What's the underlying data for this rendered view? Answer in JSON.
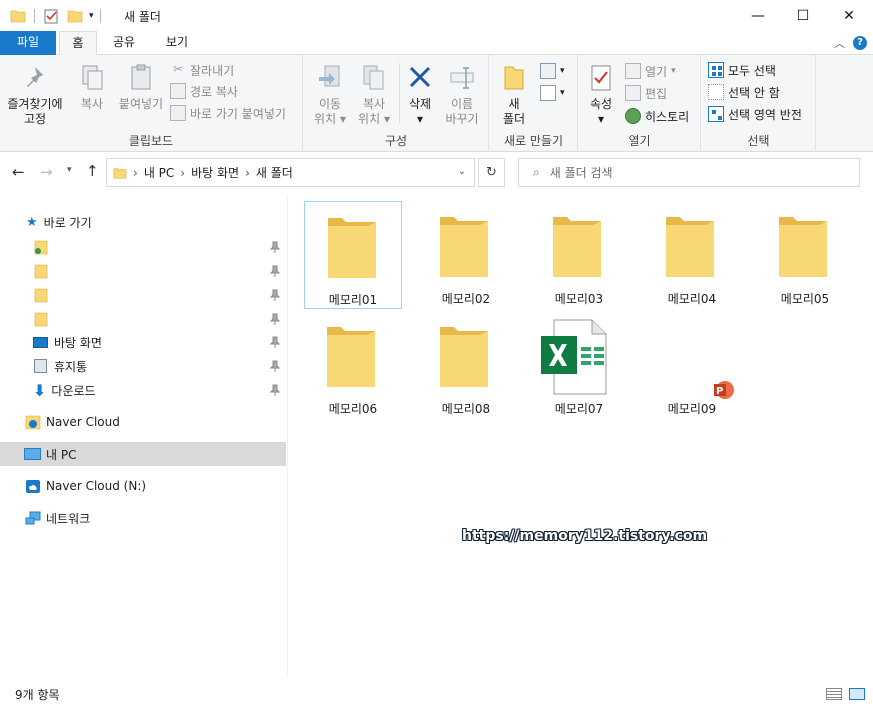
{
  "window": {
    "title": "새 폴더",
    "minimize": "—",
    "maximize": "☐",
    "close": "✕"
  },
  "tabs": {
    "file": "파일",
    "home": "홈",
    "share": "공유",
    "view": "보기"
  },
  "ribbon": {
    "clipboard": {
      "label": "클립보드",
      "pin_line1": "즐겨찾기에",
      "pin_line2": "고정",
      "copy": "복사",
      "paste": "붙여넣기",
      "cut": "잘라내기",
      "copy_path": "경로 복사",
      "paste_shortcut": "바로 가기 붙여넣기"
    },
    "organize": {
      "label": "구성",
      "move_line1": "이동",
      "move_line2": "위치",
      "copy_line1": "복사",
      "copy_line2": "위치",
      "delete": "삭제",
      "rename_line1": "이름",
      "rename_line2": "바꾸기"
    },
    "new": {
      "label": "새로 만들기",
      "new_folder_line1": "새",
      "new_folder_line2": "폴더"
    },
    "open": {
      "label": "열기",
      "properties": "속성",
      "open": "열기",
      "edit": "편집",
      "history": "히스토리"
    },
    "select": {
      "label": "선택",
      "select_all": "모두 선택",
      "select_none": "선택 안 함",
      "invert": "선택 영역 반전"
    }
  },
  "address": {
    "crumbs": [
      "내 PC",
      "바탕 화면",
      "새 폴더"
    ],
    "search_placeholder": "새 폴더 검색"
  },
  "sidebar": {
    "quick_access": "바로 가기",
    "pinned": [
      "",
      "",
      "",
      ""
    ],
    "desktop": "바탕 화면",
    "recycle": "휴지통",
    "downloads": "다운로드",
    "naver_cloud": "Naver Cloud",
    "my_pc": "내 PC",
    "naver_cloud_n": "Naver Cloud (N:)",
    "network": "네트워크"
  },
  "files": [
    "메모리01",
    "메모리02",
    "메모리03",
    "메모리04",
    "메모리05",
    "메모리06",
    "메모리08",
    "메모리07",
    "메모리09"
  ],
  "status": {
    "count": "9개 항목"
  },
  "watermark": "https://memory112.tistory.com",
  "colors": {
    "accent": "#1979ca",
    "folder": "#f8d775",
    "excel": "#107c41",
    "ppt": "#d35230"
  }
}
